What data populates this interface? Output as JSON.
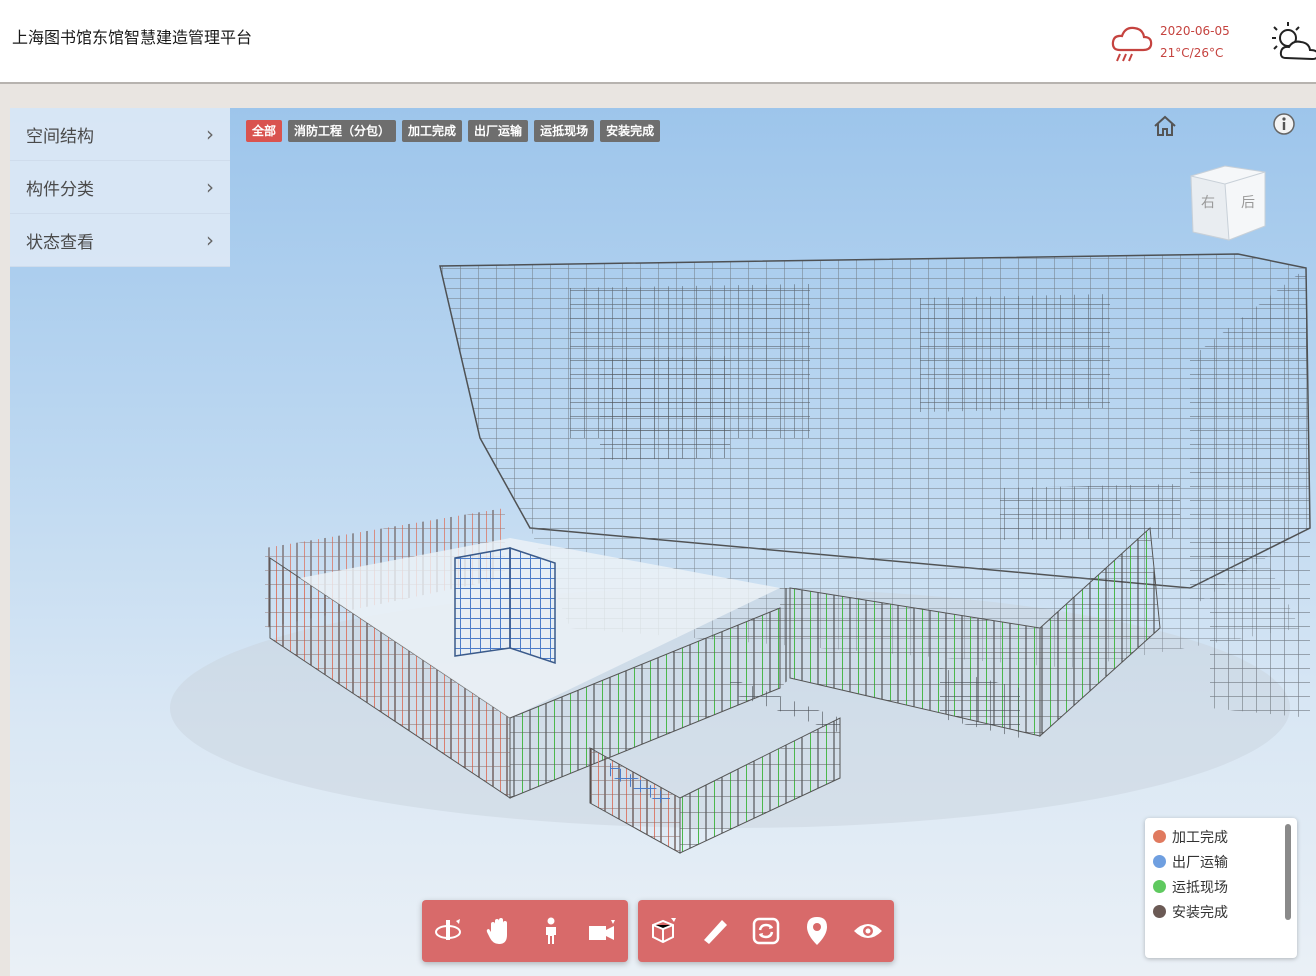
{
  "header": {
    "title": "上海图书馆东馆智慧建造管理平台",
    "weather": {
      "date": "2020-06-05",
      "temp": "21°C/26°C",
      "icon": "cloud-rain-icon",
      "color": "#c5433f"
    },
    "settings_icon": "sun-cloud-icon"
  },
  "sidebar": {
    "items": [
      {
        "label": "空间结构"
      },
      {
        "label": "构件分类"
      },
      {
        "label": "状态查看"
      }
    ]
  },
  "filters": {
    "items": [
      {
        "label": "全部",
        "active": true
      },
      {
        "label": "消防工程（分包）",
        "active": false
      },
      {
        "label": "加工完成",
        "active": false
      },
      {
        "label": "出厂运输",
        "active": false
      },
      {
        "label": "运抵现场",
        "active": false
      },
      {
        "label": "安装完成",
        "active": false
      }
    ]
  },
  "viewcube": {
    "right": "右",
    "back": "后"
  },
  "legend": {
    "items": [
      {
        "label": "加工完成",
        "color": "#e07a5f"
      },
      {
        "label": "出厂运输",
        "color": "#6f9fe0"
      },
      {
        "label": "运抵现场",
        "color": "#5fc95f"
      },
      {
        "label": "安装完成",
        "color": "#6b5a55"
      }
    ]
  },
  "toolbar": {
    "navigation_tools": [
      "orbit-icon",
      "pan-hand-icon",
      "first-person-icon",
      "camera-icon"
    ],
    "model_tools": [
      "section-box-icon",
      "measure-ruler-icon",
      "sync-icon",
      "location-pin-icon",
      "eye-icon"
    ],
    "color": "#d86a6a"
  }
}
